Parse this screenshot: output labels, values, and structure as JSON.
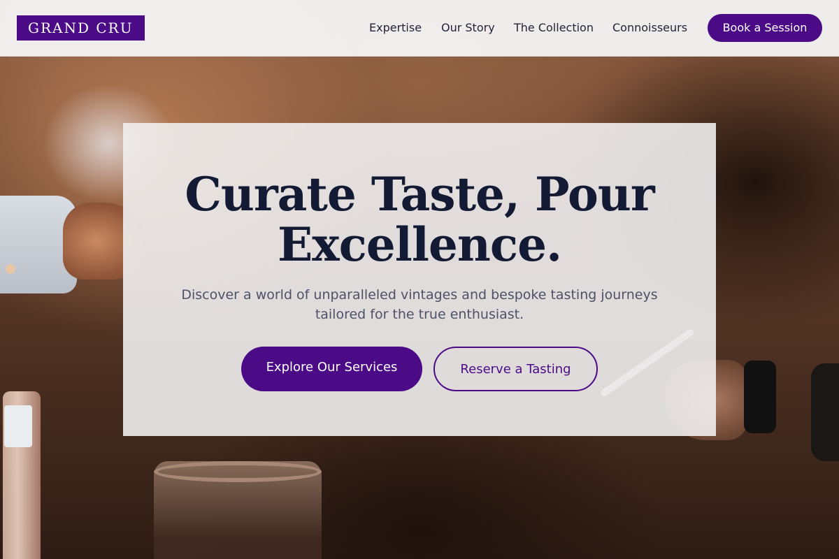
{
  "brand": {
    "logo": "GRAND CRU",
    "accent": "#4b0a86"
  },
  "nav": {
    "items": [
      {
        "label": "Expertise"
      },
      {
        "label": "Our Story"
      },
      {
        "label": "The Collection"
      },
      {
        "label": "Connoisseurs"
      }
    ],
    "cta": "Book a Session"
  },
  "hero": {
    "title": "Curate Taste, Pour Excellence.",
    "subtitle": "Discover a world of unparalleled vintages and bespoke tasting journeys tailored for the true enthusiast.",
    "primary_cta": "Explore Our Services",
    "secondary_cta": "Reserve a Tasting",
    "background": "wine-pouring-photo"
  }
}
